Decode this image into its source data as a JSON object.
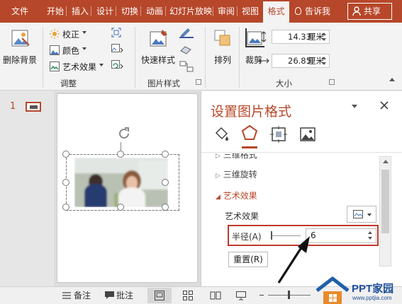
{
  "tabs": [
    "文件",
    "开始",
    "插入",
    "设计",
    "切换",
    "动画",
    "幻灯片放映",
    "审阅",
    "视图",
    "格式"
  ],
  "active_tab": "格式",
  "tell_me": "告诉我",
  "share": "共享",
  "ribbon": {
    "remove_bg": "删除背景",
    "correct": "校正",
    "color": "颜色",
    "artistic": "艺术效果",
    "adjust_label": "调整",
    "quick_styles": "快速样式",
    "picture_styles_label": "图片样式",
    "arrange": "排列",
    "crop": "裁剪",
    "height": "14.33",
    "width": "26.85",
    "unit": "厘米",
    "size_label": "大小"
  },
  "slide_number": "1",
  "pane": {
    "title": "设置图片格式",
    "section_partial": "三维格式",
    "section_3d_rotation": "三维旋转",
    "section_artistic": "艺术效果",
    "artistic_label": "艺术效果",
    "radius_label": "半径(A)",
    "radius_value": "6",
    "reset": "重置(R)"
  },
  "status": {
    "notes": "备注",
    "comments": "批注"
  },
  "watermark": {
    "text": "PPT家园",
    "url": "www.pptjia.com"
  },
  "colors": {
    "accent": "#b7472a",
    "highlight_border": "#c0392b"
  }
}
